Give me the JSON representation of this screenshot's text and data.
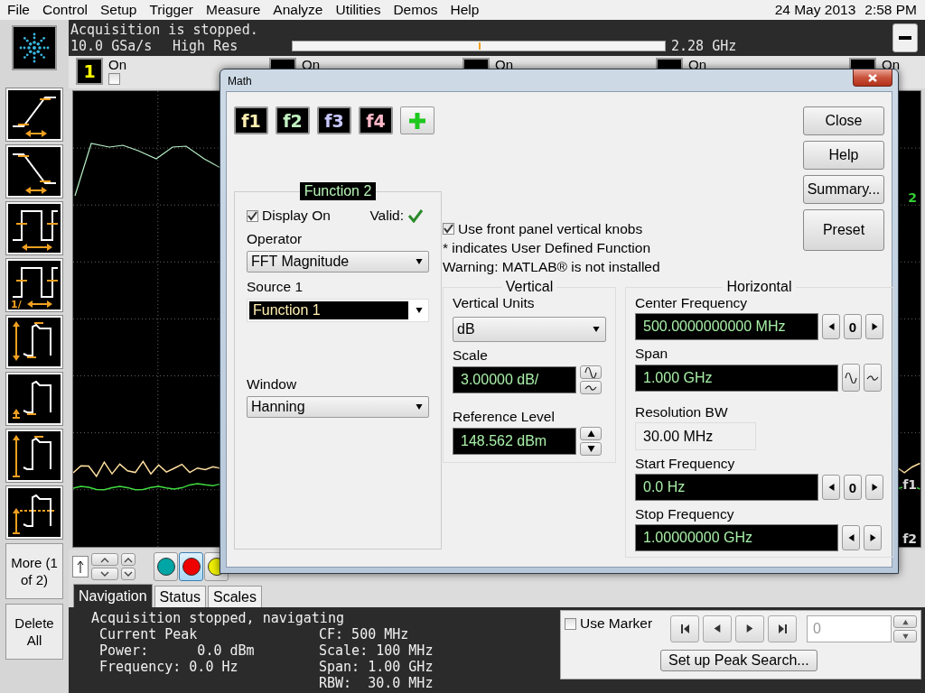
{
  "menu": [
    "File",
    "Control",
    "Setup",
    "Trigger",
    "Measure",
    "Analyze",
    "Utilities",
    "Demos",
    "Help"
  ],
  "clock": {
    "date": "24 May 2013",
    "time": "2:58 PM"
  },
  "tools": [
    {
      "kind": "rise"
    },
    {
      "kind": "fall"
    },
    {
      "kind": "width"
    },
    {
      "kind": "period",
      "label": "1/"
    },
    {
      "kind": "amplitude"
    },
    {
      "kind": "base"
    },
    {
      "kind": "top"
    },
    {
      "kind": "middle"
    }
  ],
  "more_button": "More (1 of 2)",
  "delete_button": "Delete All",
  "acquisition": {
    "status": "Acquisition is stopped.",
    "sample_rate": "10.0 GSa/s",
    "mode": "High Res",
    "bandwidth": "2.28 GHz"
  },
  "channels": [
    {
      "number": "1",
      "label": "On",
      "checked": false,
      "color": "#ffff00"
    },
    {
      "label": "On"
    },
    {
      "label": "On"
    },
    {
      "label": "On"
    },
    {
      "label": "On"
    }
  ],
  "display": {
    "markers": [
      {
        "label": "2",
        "color": "#33cc33"
      },
      {
        "label": "f1",
        "color": "#d8d8d8"
      },
      {
        "label": "f2",
        "color": "#d8d8d8"
      }
    ]
  },
  "color_buttons": [
    {
      "color": "#00a5a5",
      "selected": false
    },
    {
      "color": "#ee0000",
      "selected": true
    },
    {
      "color": "#eeee00",
      "selected": false
    }
  ],
  "tabs": [
    {
      "label": "Navigation",
      "selected": true
    },
    {
      "label": "Status",
      "selected": false
    },
    {
      "label": "Scales",
      "selected": false
    }
  ],
  "navigation": {
    "status": "Acquisition stopped, navigating",
    "peak_lines": [
      "Current Peak",
      "Power:      0.0 dBm",
      "Frequency: 0.0 Hz"
    ],
    "readouts": [
      "CF: 500 MHz",
      "Scale: 100 MHz",
      "Span: 1.00 GHz",
      "RBW:  30.0 MHz"
    ],
    "use_marker": {
      "label": "Use Marker",
      "checked": false
    },
    "marker_value": "0",
    "peak_search_button": "Set up Peak Search..."
  },
  "math_dialog": {
    "title": "Math",
    "functions": [
      {
        "label": "f1",
        "color": "#ffeeb0"
      },
      {
        "label": "f2",
        "color": "#c0f0c0"
      },
      {
        "label": "f3",
        "color": "#c8c8ff"
      },
      {
        "label": "f4",
        "color": "#ffb8c8"
      }
    ],
    "buttons": [
      "Close",
      "Help",
      "Summary...",
      "Preset"
    ],
    "function_group": {
      "title": "Function 2",
      "display_on": {
        "label": "Display On",
        "checked": true
      },
      "valid": {
        "label": "Valid:",
        "ok": true
      },
      "operator": {
        "label": "Operator",
        "value": "FFT Magnitude"
      },
      "source": {
        "label": "Source 1",
        "value": "Function 1"
      },
      "window": {
        "label": "Window",
        "value": "Hanning"
      }
    },
    "front_panel_knobs": {
      "label": "Use front panel vertical knobs",
      "checked": true
    },
    "notes": [
      "* indicates User Defined Function",
      "Warning: MATLAB® is not installed"
    ],
    "vertical": {
      "title": "Vertical",
      "fields": [
        {
          "kind": "select",
          "label": "Vertical Units",
          "value": "dB"
        },
        {
          "kind": "wave",
          "label": "Scale",
          "value": "3.00000 dB/"
        },
        {
          "kind": "updown",
          "label": "Reference Level",
          "value": "148.562 dBm"
        }
      ]
    },
    "horizontal": {
      "title": "Horizontal",
      "fields": [
        {
          "kind": "stepper",
          "label": "Center Frequency",
          "value": "500.0000000000 MHz",
          "reset": "0"
        },
        {
          "kind": "wave",
          "label": "Span",
          "value": "1.000 GHz"
        },
        {
          "kind": "readonly",
          "label": "Resolution BW",
          "value": "30.00 MHz"
        },
        {
          "kind": "stepper",
          "label": "Start Frequency",
          "value": "0.0 Hz",
          "reset": "0"
        },
        {
          "kind": "arrows",
          "label": "Stop Frequency",
          "value": "1.00000000 GHz"
        }
      ]
    }
  }
}
